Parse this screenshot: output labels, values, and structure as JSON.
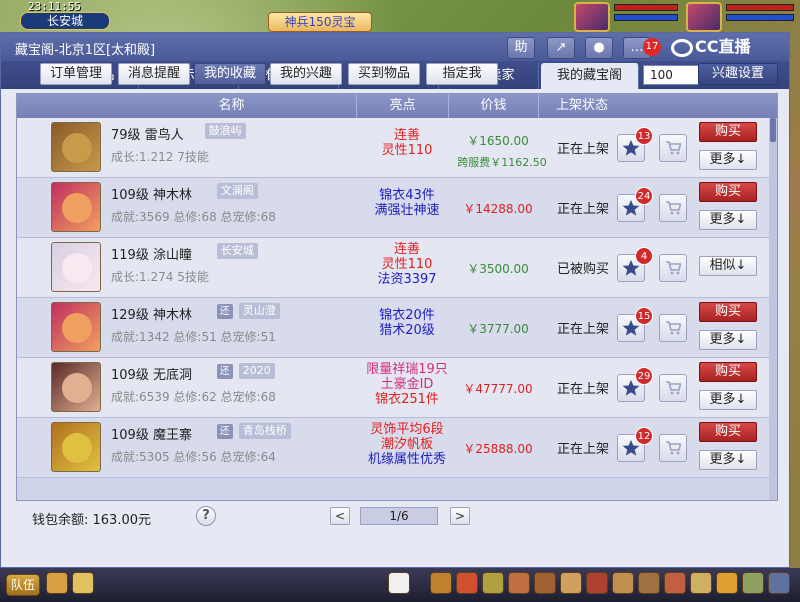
{
  "game": {
    "clock": "23:11:55",
    "city": "长安城",
    "banner": "神兵150灵宝",
    "hud_team": "队伍"
  },
  "window": {
    "title": "藏宝阁-北京1区[太和殿]",
    "notif_count": "17",
    "logo_text": "CC直播",
    "toolbar_icons": [
      "helper-icon",
      "share-icon",
      "settings-icon",
      "chat-icon"
    ],
    "toolbar_labels": [
      "助",
      "↗",
      "●",
      "…"
    ]
  },
  "tabs": [
    "浏览商品",
    "公示期",
    "推荐商品",
    "定制推荐",
    "我是卖家",
    "我的藏宝阁"
  ],
  "active_tab": "我的藏宝阁",
  "search": {
    "value": "100"
  },
  "subtabs": [
    "订单管理",
    "消息提醒",
    "我的收藏",
    "我的兴趣",
    "买到物品",
    "指定我"
  ],
  "active_subtab": "我的收藏",
  "interest_button": "兴趣设置",
  "columns": [
    "名称",
    "亮点",
    "价钱",
    "上架状态"
  ],
  "rows": [
    {
      "level_name": "79级  雷鸟人",
      "huan": "",
      "server": "鼓浪屿",
      "stats": "成长:1.212 7技能",
      "highlights": [
        {
          "text": "连善",
          "color": "#e02020"
        },
        {
          "text": "灵性110",
          "color": "#e02020"
        }
      ],
      "price": "￥1650.00",
      "price_color": "#3a8a3a",
      "fee": "跨服费￥1162.50",
      "status": "正在上架",
      "fav_count": "13",
      "buy": "购买",
      "more": "更多↓",
      "avatar_colors": [
        "#8a5a2a",
        "#c89a4a"
      ]
    },
    {
      "level_name": "109级  神木林",
      "huan": "",
      "server": "文澜阁",
      "stats": "成就:3569 总修:68 总宠修:68",
      "highlights": [
        {
          "text": "锦衣43件",
          "color": "#2020c0"
        },
        {
          "text": "满强壮神速",
          "color": "#2020c0"
        }
      ],
      "price": "￥14288.00",
      "price_color": "#e02020",
      "fee": "",
      "status": "正在上架",
      "fav_count": "24",
      "buy": "购买",
      "more": "更多↓",
      "avatar_colors": [
        "#c03060",
        "#f0a060"
      ]
    },
    {
      "level_name": "119级  涂山瞳",
      "huan": "",
      "server": "长安城",
      "stats": "成长:1.274 5技能",
      "highlights": [
        {
          "text": "连善",
          "color": "#e02020"
        },
        {
          "text": "灵性110",
          "color": "#e02020"
        },
        {
          "text": "法资3397",
          "color": "#2020c0"
        }
      ],
      "price": "￥3500.00",
      "price_color": "#3a8a3a",
      "fee": "",
      "status": "已被购买",
      "fav_count": "4",
      "similar": "相似↓",
      "avatar_colors": [
        "#d8d0e0",
        "#f8e8f0"
      ]
    },
    {
      "level_name": "129级  神木林",
      "huan": "还",
      "server": "灵山澄",
      "stats": "成就:1342 总修:51 总宠修:51",
      "highlights": [
        {
          "text": "锦衣20件",
          "color": "#2020c0"
        },
        {
          "text": "猎术20级",
          "color": "#2020c0"
        }
      ],
      "price": "￥3777.00",
      "price_color": "#3a8a3a",
      "fee": "",
      "status": "正在上架",
      "fav_count": "15",
      "buy": "购买",
      "more": "更多↓",
      "avatar_colors": [
        "#c03060",
        "#f0a060"
      ]
    },
    {
      "level_name": "109级  无底洞",
      "huan": "还",
      "server": "2020",
      "stats": "成就:6539 总修:62 总宠修:68",
      "highlights": [
        {
          "text": "限量祥瑞19只",
          "color": "#d03080"
        },
        {
          "text": "土豪金ID",
          "color": "#d03080"
        },
        {
          "text": "锦衣251件",
          "color": "#e02020"
        }
      ],
      "price": "￥47777.00",
      "price_color": "#e02020",
      "fee": "",
      "status": "正在上架",
      "fav_count": "29",
      "buy": "购买",
      "more": "更多↓",
      "avatar_colors": [
        "#5a2a2a",
        "#e0b090"
      ]
    },
    {
      "level_name": "109级  魔王寨",
      "huan": "还",
      "server": "青岛栈桥",
      "stats": "成就:5305 总修:56 总宠修:64",
      "highlights": [
        {
          "text": "灵饰平均6段",
          "color": "#e02020"
        },
        {
          "text": "潮汐帆板",
          "color": "#e02020"
        },
        {
          "text": "机缘属性优秀",
          "color": "#2020c0"
        }
      ],
      "price": "￥25888.00",
      "price_color": "#e02020",
      "fee": "",
      "status": "正在上架",
      "fav_count": "12",
      "buy": "购买",
      "more": "更多↓",
      "avatar_colors": [
        "#b07020",
        "#e0c040"
      ]
    }
  ],
  "footer": {
    "balance": "钱包余额: 163.00元",
    "help": "?",
    "page": "1/6",
    "prev": "<",
    "next": ">"
  }
}
